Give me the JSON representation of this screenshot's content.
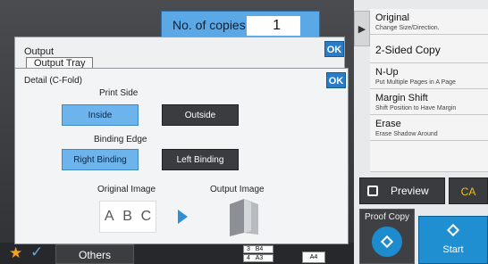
{
  "copies": {
    "label": "No. of copies",
    "value": "1"
  },
  "output_dialog": {
    "title": "Output",
    "tray": "Output Tray",
    "ok": "OK"
  },
  "detail": {
    "title": "Detail (C-Fold)",
    "ok": "OK",
    "print_side": {
      "label": "Print Side",
      "options": [
        "Inside",
        "Outside"
      ],
      "selected": "Inside"
    },
    "binding_edge": {
      "label": "Binding Edge",
      "options": [
        "Right Binding",
        "Left Binding"
      ],
      "selected": "Right Binding"
    },
    "original_image": {
      "label": "Original Image",
      "letters": [
        "A",
        "B",
        "C"
      ]
    },
    "output_image": {
      "label": "Output Image"
    }
  },
  "menu": [
    {
      "title": "Original",
      "subtitle": "Change Size/Direction."
    },
    {
      "title": "2-Sided Copy",
      "subtitle": ""
    },
    {
      "title": "N-Up",
      "subtitle": "Put Multiple Pages in A Page"
    },
    {
      "title": "Margin Shift",
      "subtitle": "Shift Position to Have Margin"
    },
    {
      "title": "Erase",
      "subtitle": "Erase Shadow Around"
    }
  ],
  "buttons": {
    "preview": "Preview",
    "ca": "CA",
    "proof_copy": "Proof Copy",
    "start": "Start",
    "others": "Others"
  },
  "trays": {
    "row1_num": "3",
    "row1_size": "B4",
    "row2_num": "4",
    "row2_size": "A3",
    "bypass": "A4"
  },
  "colors": {
    "accent": "#2a7cc4",
    "selected": "#6db3ec",
    "start": "#1f8fd2",
    "favorite": "#f3a21a",
    "ca": "#f2c200"
  }
}
